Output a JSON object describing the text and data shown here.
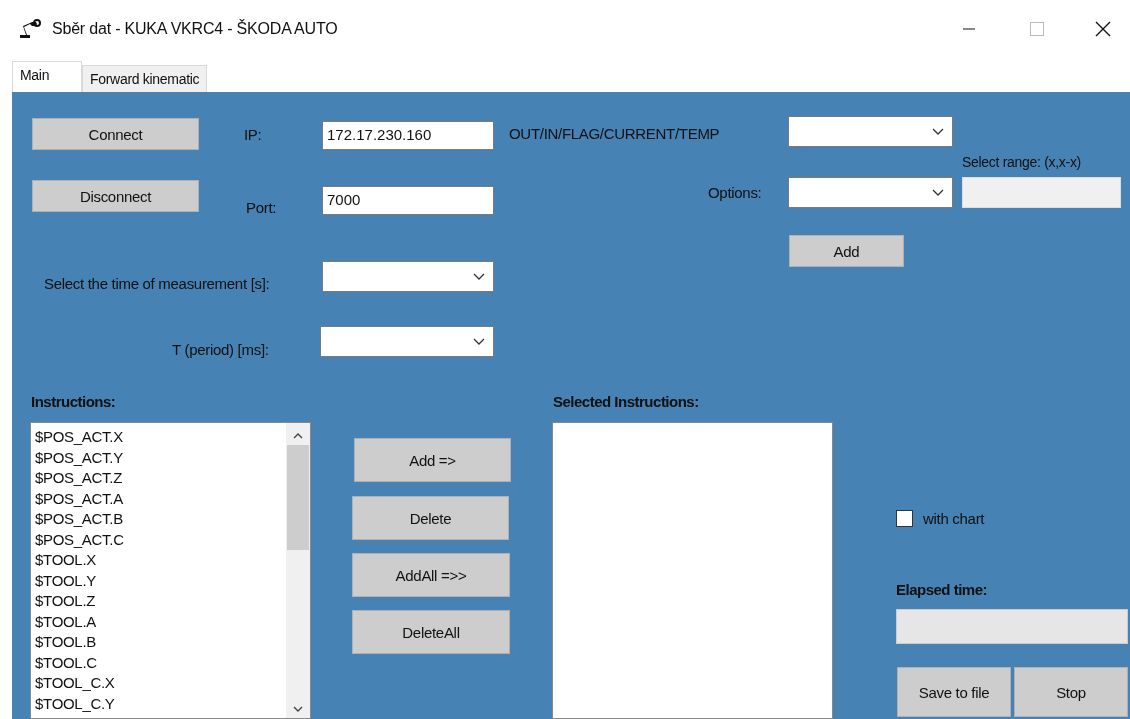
{
  "window": {
    "title": "Sběr dat - KUKA VKRC4 - ŠKODA AUTO"
  },
  "tabs": [
    {
      "label": "Main",
      "selected": true
    },
    {
      "label": "Forward kinematic",
      "selected": false
    }
  ],
  "connection": {
    "connect_button": "Connect",
    "disconnect_button": "Disconnect",
    "ip_label": "IP:",
    "ip_value": "172.17.230.160",
    "port_label": "Port:",
    "port_value": "7000"
  },
  "signal": {
    "type_label": "OUT/IN/FLAG/CURRENT/TEMP",
    "options_label": "Options:",
    "range_label": "Select range: (x,x-x)",
    "add_button": "Add"
  },
  "timing": {
    "measurement_label": "Select the time of measurement [s]:",
    "period_label": "T (period) [ms]:"
  },
  "instructions": {
    "label": "Instructions:",
    "items": [
      "$POS_ACT.X",
      "$POS_ACT.Y",
      "$POS_ACT.Z",
      "$POS_ACT.A",
      "$POS_ACT.B",
      "$POS_ACT.C",
      "$TOOL.X",
      "$TOOL.Y",
      "$TOOL.Z",
      "$TOOL.A",
      "$TOOL.B",
      "$TOOL.C",
      "$TOOL_C.X",
      "$TOOL_C.Y"
    ]
  },
  "transfer_buttons": [
    "Add =>",
    "Delete",
    "AddAll =>>",
    "DeleteAll"
  ],
  "selected_instructions": {
    "label": "Selected Instructions:"
  },
  "with_chart": {
    "label": "with chart",
    "checked": false
  },
  "elapsed": {
    "label": "Elapsed time:"
  },
  "buttons": [
    "Save to file",
    "Stop"
  ]
}
